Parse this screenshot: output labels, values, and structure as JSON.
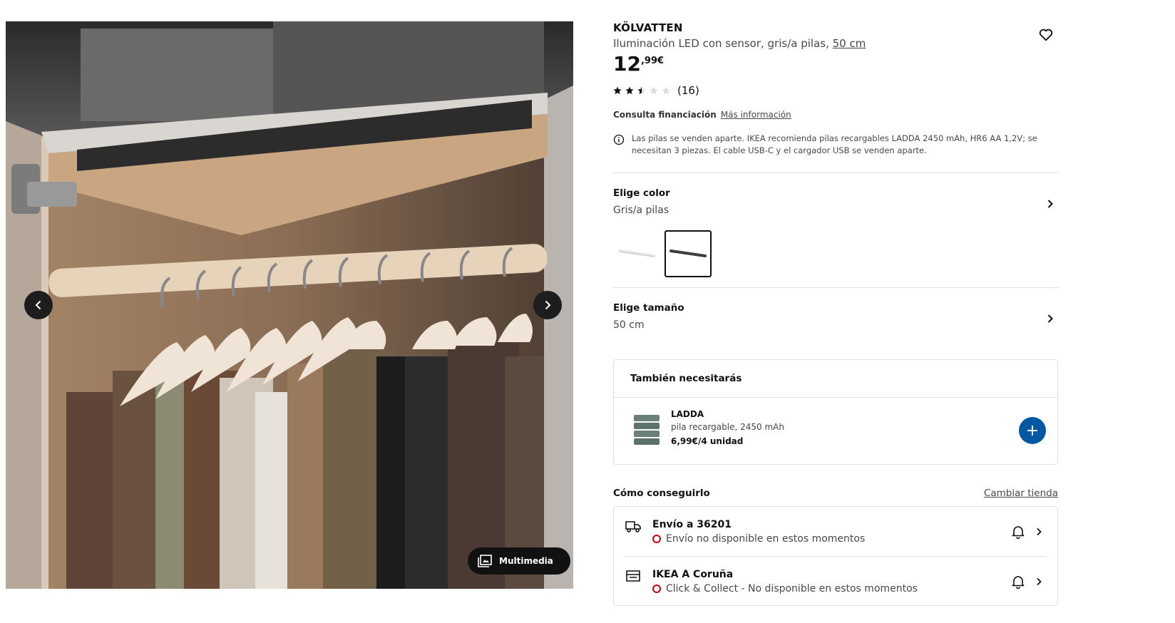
{
  "product": {
    "name": "KÖLVATTEN",
    "description": "Iluminación LED con sensor, gris/a pilas, ",
    "size_link": "50 cm",
    "price_int": "12",
    "price_dec": ",99€",
    "rating_value": 2.5,
    "rating_max": 5,
    "rating_count": "(16)"
  },
  "finance": {
    "label": "Consulta financiación",
    "link": "Más información"
  },
  "note": "Las pilas se venden aparte. IKEA recomienda pilas recargables LADDA 2450 mAh, HR6 AA 1,2V; se necesitan 3 piezas. El cable USB-C y el cargador USB se venden aparte.",
  "color": {
    "title": "Elige color",
    "value": "Gris/a pilas",
    "swatches": [
      "white",
      "gray"
    ]
  },
  "size": {
    "title": "Elige tamaño",
    "value": "50 cm"
  },
  "also_need": {
    "title": "También necesitarás",
    "item": {
      "name": "LADDA",
      "desc": "pila recargable, 2450 mAh",
      "price": "6,99€/4 unidad"
    }
  },
  "how": {
    "title": "Cómo conseguirlo",
    "change_store": "Cambiar tienda",
    "delivery": {
      "title": "Envío a 36201",
      "status": "Envío no disponible en estos momentos"
    },
    "store": {
      "title": "IKEA A Coruña",
      "status": "Click & Collect - No disponible en estos momentos"
    }
  },
  "gallery": {
    "media_label": "Multimedia"
  },
  "colors": {
    "accent": "#0058a3",
    "error": "#cc0008"
  }
}
